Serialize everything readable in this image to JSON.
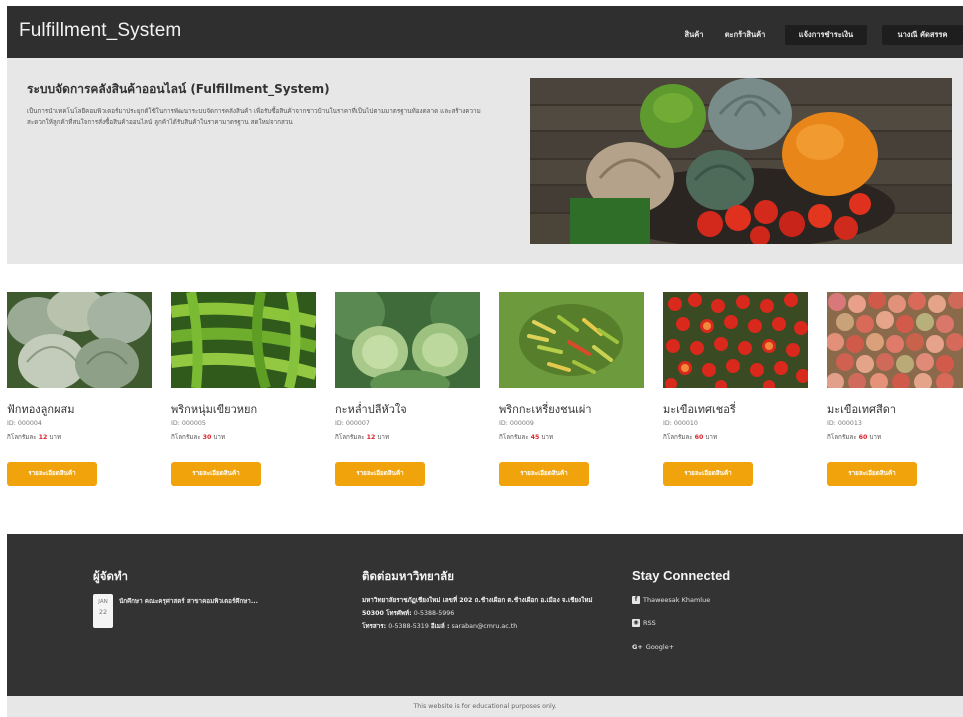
{
  "navbar": {
    "brand": "Fulfillment_System",
    "items": [
      {
        "label": "สินค้า"
      },
      {
        "label": "ตะกร้าสินค้า"
      },
      {
        "label": "แจ้งการชำระเงิน"
      },
      {
        "label": "นางณี คัดสรรค"
      }
    ]
  },
  "hero": {
    "title": "ระบบจัดการคลังสินค้าออนไลน์ (Fulfillment_System)",
    "description": "เป็นการนำเทคโนโลยีคอมพิวเตอร์มาประยุกต์ใช้ในการพัฒนาระบบจัดการคลังสินค้า เพื่อรับซื้อสินค้าจากชาวบ้านในราคาที่เป็นไปตามมาตรฐานท้องตลาด และสร้างความสะดวกให้ลูกค้าที่สนใจการสั่งซื้อสินค้าออนไลน์ ลูกค้าได้รับสินค้าในราคามาตรฐาน สดใหม่จากสวน"
  },
  "products": [
    {
      "name": "ฟักทองลูกผสม",
      "id": "ID: 000004",
      "price_label": "กิโลกรัมละ",
      "price": "12",
      "unit": "บาท",
      "button": "รายละเอียดสินค้า"
    },
    {
      "name": "พริกหนุ่มเขียวหยก",
      "id": "ID: 000005",
      "price_label": "กิโลกรัมละ",
      "price": "30",
      "unit": "บาท",
      "button": "รายละเอียดสินค้า"
    },
    {
      "name": "กะหล่ำปลีหัวใจ",
      "id": "ID: 000007",
      "price_label": "กิโลกรัมละ",
      "price": "12",
      "unit": "บาท",
      "button": "รายละเอียดสินค้า"
    },
    {
      "name": "พริกกะเหรี่ยงชนเผ่า",
      "id": "ID: 000009",
      "price_label": "กิโลกรัมละ",
      "price": "45",
      "unit": "บาท",
      "button": "รายละเอียดสินค้า"
    },
    {
      "name": "มะเขือเทศเชอรี่",
      "id": "ID: 000010",
      "price_label": "กิโลกรัมละ",
      "price": "60",
      "unit": "บาท",
      "button": "รายละเอียดสินค้า"
    },
    {
      "name": "มะเขือเทศสีดา",
      "id": "ID: 000013",
      "price_label": "กิโลกรัมละ",
      "price": "60",
      "unit": "บาท",
      "button": "รายละเอียดสินค้า"
    }
  ],
  "footer": {
    "organizer": {
      "heading": "ผู้จัดทำ",
      "date_month": "JAN",
      "date_day": "22",
      "post": "นักศึกษา คณะครุศาสตร์ สาขาคอมพิวเตอร์ศึกษา..."
    },
    "contact": {
      "heading": "ติดต่อมหาวิทยาลัย",
      "address": "มหาวิทยาลัยราชภัฏเชียงใหม่ เลขที่ 202 ถ.ช้างเผือก ต.ช้างเผือก อ.เมือง จ.เชียงใหม่ 50300",
      "phone_label": "โทรศัพท์:",
      "phone": "0-5388-5996",
      "fax_label": "โทรสาร:",
      "fax": "0-5388-5319",
      "email_label": "อีเมล์ :",
      "email": "saraban@cmru.ac.th"
    },
    "social": {
      "heading": "Stay Connected",
      "items": [
        {
          "icon": "facebook-icon",
          "label": "Thaweesak Khamlue"
        },
        {
          "icon": "rss-icon",
          "label": "RSS"
        },
        {
          "icon": "google-plus-icon",
          "label": "Google+"
        }
      ]
    }
  },
  "bottom": {
    "text": "This website is for educational purposes only."
  }
}
